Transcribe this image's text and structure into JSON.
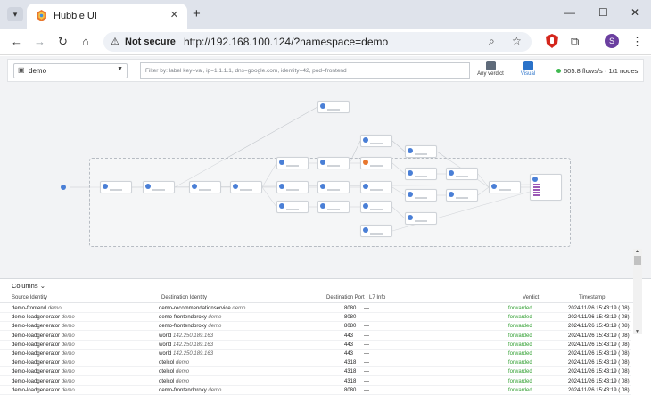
{
  "browser": {
    "tab_title": "Hubble UI",
    "new_tab_glyph": "+",
    "security_label": "Not secure",
    "url": "http://192.168.100.124/?namespace=demo",
    "profile_initial": "S"
  },
  "toolbar": {
    "namespace": "demo",
    "filter_placeholder": "Filter by: label key=val, ip=1.1.1.1, dns=google.com, identity=42, pod=frontend",
    "any_verdict_label": "Any verdict",
    "visual_label": "Visual",
    "flows_rate": "605.8 flows/s",
    "nodes": "1/1 nodes"
  },
  "colors": {
    "accent_blue": "#4a7fd6",
    "verdict_green": "#2e9e2e",
    "flows_dot": "#3fb950"
  },
  "table": {
    "columns_label": "Columns",
    "headers": {
      "source": "Source Identity",
      "destination": "Destination Identity",
      "port": "Destination Port",
      "l7": "L7 Info",
      "verdict": "Verdict",
      "timestamp": "Timestamp"
    },
    "rows": [
      {
        "src": "demo-frontend",
        "src_ns": "demo",
        "dst": "demo-recommendationservice",
        "dst_ns": "demo",
        "port": "8080",
        "l7": "—",
        "verdict": "forwarded",
        "time": "2024/11/26 15:43:19 ( 08)"
      },
      {
        "src": "demo-loadgenerator",
        "src_ns": "demo",
        "dst": "demo-frontendproxy",
        "dst_ns": "demo",
        "port": "8080",
        "l7": "—",
        "verdict": "forwarded",
        "time": "2024/11/26 15:43:19 ( 08)"
      },
      {
        "src": "demo-loadgenerator",
        "src_ns": "demo",
        "dst": "demo-frontendproxy",
        "dst_ns": "demo",
        "port": "8080",
        "l7": "—",
        "verdict": "forwarded",
        "time": "2024/11/26 15:43:19 ( 08)"
      },
      {
        "src": "demo-loadgenerator",
        "src_ns": "demo",
        "dst": "world",
        "dst_ns": "142.250.189.163",
        "port": "443",
        "l7": "—",
        "verdict": "forwarded",
        "time": "2024/11/26 15:43:19 ( 08)"
      },
      {
        "src": "demo-loadgenerator",
        "src_ns": "demo",
        "dst": "world",
        "dst_ns": "142.250.189.163",
        "port": "443",
        "l7": "—",
        "verdict": "forwarded",
        "time": "2024/11/26 15:43:19 ( 08)"
      },
      {
        "src": "demo-loadgenerator",
        "src_ns": "demo",
        "dst": "world",
        "dst_ns": "142.250.189.163",
        "port": "443",
        "l7": "—",
        "verdict": "forwarded",
        "time": "2024/11/26 15:43:19 ( 08)"
      },
      {
        "src": "demo-loadgenerator",
        "src_ns": "demo",
        "dst": "otelcol",
        "dst_ns": "demo",
        "port": "4318",
        "l7": "—",
        "verdict": "forwarded",
        "time": "2024/11/26 15:43:19 ( 08)"
      },
      {
        "src": "demo-loadgenerator",
        "src_ns": "demo",
        "dst": "otelcol",
        "dst_ns": "demo",
        "port": "4318",
        "l7": "—",
        "verdict": "forwarded",
        "time": "2024/11/26 15:43:19 ( 08)"
      },
      {
        "src": "demo-loadgenerator",
        "src_ns": "demo",
        "dst": "otelcol",
        "dst_ns": "demo",
        "port": "4318",
        "l7": "—",
        "verdict": "forwarded",
        "time": "2024/11/26 15:43:19 ( 08)"
      },
      {
        "src": "demo-loadgenerator",
        "src_ns": "demo",
        "dst": "demo-frontendproxy",
        "dst_ns": "demo",
        "port": "8080",
        "l7": "—",
        "verdict": "forwarded",
        "time": "2024/11/26 15:43:19 ( 08)"
      }
    ]
  }
}
